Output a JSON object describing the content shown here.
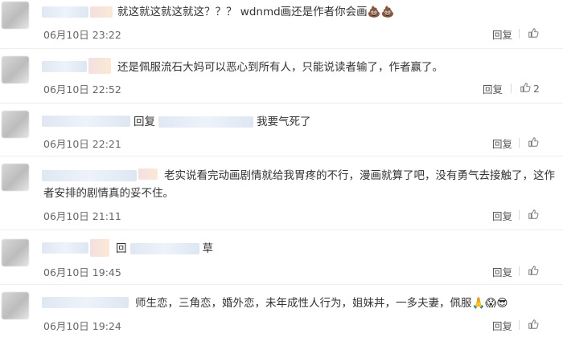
{
  "comments": [
    {
      "text": "就这就这就这就这？？？ wdnmd画还是作者你会画💩💩",
      "time": "06月10日 23:22",
      "reply": "回复",
      "likes": ""
    },
    {
      "text": "还是佩服流石大妈可以恶心到所有人，只能说读者输了，作者赢了。",
      "time": "06月10日 22:52",
      "reply": "回复",
      "likes": "2"
    },
    {
      "reply_prefix": "回复",
      "text": "我要气死了",
      "time": "06月10日 22:21",
      "reply": "回复",
      "likes": ""
    },
    {
      "text": "老实说看完动画剧情就给我胃疼的不行，漫画就算了吧，没有勇气去接触了，这作者安排的剧情真的妥不住。",
      "time": "06月10日 21:11",
      "reply": "回复",
      "likes": ""
    },
    {
      "reply_prefix": "回",
      "text": "草",
      "time": "06月10日 19:45",
      "reply": "回复",
      "likes": ""
    },
    {
      "text": "师生恋，三角恋，婚外恋，未年成性人行为，姐妹丼，一多夫妻，佩服🙏😱😎",
      "time": "06月10日 19:24",
      "reply": "回复",
      "likes": ""
    }
  ],
  "icons": {
    "like": "thumbs-up-icon"
  }
}
